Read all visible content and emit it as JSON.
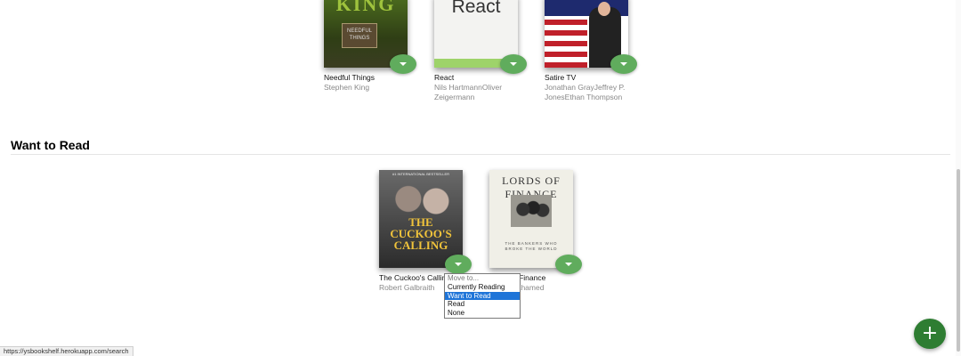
{
  "shelves": {
    "previous": {
      "books": [
        {
          "title": "Needful Things",
          "authors": "Stephen King",
          "cover_text": "KING",
          "cover_sign": "NEEDFUL THINGS"
        },
        {
          "title": "React",
          "authors": "Nils HartmannOliver Zeigermann",
          "cover_text": "React"
        },
        {
          "title": "Satire TV",
          "authors": "Jonathan GrayJeffrey P. JonesEthan Thompson"
        }
      ]
    },
    "want_to_read": {
      "title": "Want to Read",
      "books": [
        {
          "title": "The Cuckoo's Calling",
          "authors": "Robert Galbraith",
          "cover_text": "THE CUCKOO'S CALLING",
          "cover_small": "#1 INTERNATIONAL BESTSELLER"
        },
        {
          "title": "Lords of Finance",
          "authors": "Liaquat Ahamed",
          "cover_text": "LORDS OF FINANCE",
          "cover_sub": "THE BANKERS WHO BROKE THE WORLD"
        }
      ]
    }
  },
  "dropdown": {
    "options": [
      "Move to...",
      "Currently Reading",
      "Want to Read",
      "Read",
      "None"
    ],
    "selected": "Want to Read"
  },
  "status_url": "https://ysbookshelf.herokuapp.com/search",
  "fab_label": "+",
  "colors": {
    "accent_green": "#60ac5d",
    "fab_green": "#2e7d32",
    "select_blue": "#1e74d8"
  }
}
